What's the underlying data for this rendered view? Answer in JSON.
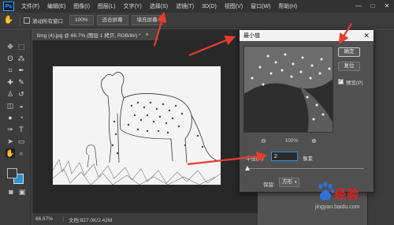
{
  "app": {
    "logo": "Ps"
  },
  "menu": [
    "文件(F)",
    "编辑(E)",
    "图像(I)",
    "图层(L)",
    "文字(Y)",
    "选择(S)",
    "滤镜(T)",
    "3D(D)",
    "视图(V)",
    "窗口(W)",
    "帮助(H)"
  ],
  "window_controls": {
    "minimize": "—",
    "maximize": "□",
    "close": "✕"
  },
  "options_bar": {
    "scroll_all_label": "滚动所有窗口",
    "zoom_value": "100%",
    "fit_screen_label": "适合屏幕",
    "fill_screen_label": "填充屏幕"
  },
  "document": {
    "tab_title": "timg (4).jpg @ 66.7% (图层 1 拷贝, RGB/8#) *",
    "tab_close": "×"
  },
  "status": {
    "zoom": "66.67%",
    "doc_size": "文档:827.0K/2.42M"
  },
  "dialog": {
    "title": "最小值",
    "close": "✕",
    "ok_label": "确定",
    "reset_label": "复位",
    "preview_label": "预览(P)",
    "preview_checked": "✓",
    "zoom_out": "⊖",
    "zoom_level": "100%",
    "zoom_in": "⊕",
    "radius_label": "半径(R):",
    "radius_value": "2",
    "radius_unit": "像素",
    "preserve_label": "保留:",
    "preserve_value": "方形"
  },
  "watermark": {
    "brand": "经验",
    "url": "jingyan.baidu.com"
  },
  "colors": {
    "accent": "#2a93d8",
    "arrow": "#e83c2f"
  }
}
